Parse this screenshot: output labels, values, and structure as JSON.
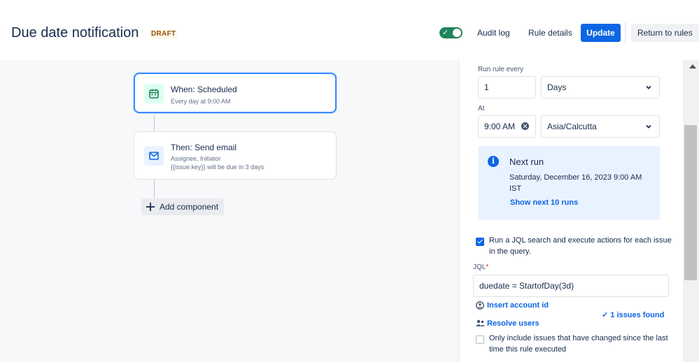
{
  "header": {
    "title": "Due date notification",
    "status_badge": "DRAFT",
    "enabled": true,
    "audit_log_label": "Audit log",
    "rule_details_label": "Rule details",
    "update_label": "Update",
    "return_label": "Return to rules"
  },
  "flow": {
    "trigger": {
      "title": "When: Scheduled",
      "subtitle": "Every day at 9:00 AM",
      "icon": "calendar-icon"
    },
    "action": {
      "title": "Then: Send email",
      "line1": "Assignee, Initiator",
      "line2": "{{issue.key}} will be due in 3 days",
      "icon": "mail-icon"
    },
    "add_component_label": "Add component"
  },
  "panel": {
    "run_every_label": "Run rule every",
    "interval_value": "1",
    "interval_unit": "Days",
    "at_label": "At",
    "time_value": "9:00 AM",
    "timezone": "Asia/Calcutta",
    "next_run": {
      "title": "Next run",
      "value": "Saturday, December 16, 2023 9:00 AM IST",
      "show_more": "Show next 10 runs"
    },
    "jql_checkbox": {
      "checked": true,
      "label": "Run a JQL search and execute actions for each issue in the query."
    },
    "jql_label": "JQL",
    "jql_value": "duedate = StartofDay(3d)",
    "insert_account_label": "Insert account id",
    "issues_found": "1 issues found",
    "resolve_users_label": "Resolve users",
    "only_changed_checkbox": {
      "checked": false,
      "label": "Only include issues that have changed since the last time this rule executed"
    }
  },
  "colors": {
    "primary": "#0c66e4",
    "toggle_on": "#1f845a",
    "info_bg": "#e9f2ff",
    "canvas_bg": "#f7f8f9"
  }
}
